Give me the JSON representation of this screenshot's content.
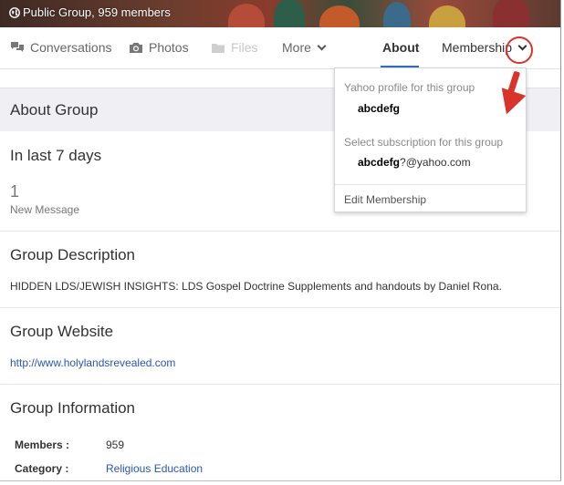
{
  "banner": {
    "group_status": "Public Group, 959 members"
  },
  "nav": {
    "conversations": "Conversations",
    "photos": "Photos",
    "files": "Files",
    "more": "More",
    "about": "About",
    "membership": "Membership"
  },
  "about": {
    "header": "About Group",
    "last7_title": "In last 7 days",
    "message_count": "1",
    "message_label": "New Message",
    "description_title": "Group Description",
    "description_text": "HIDDEN LDS/JEWISH INSIGHTS: LDS Gospel Doctrine Supplements and handouts by Daniel Rona.",
    "website_title": "Group Website",
    "website_url": "http://www.holylandsrevealed.com",
    "info_title": "Group Information",
    "members_label": "Members :",
    "members_value": "959",
    "category_label": "Category :",
    "category_value": "Religious Education"
  },
  "membership_menu": {
    "profile_label": "Yahoo profile for this group",
    "profile_name": "abcdefg",
    "subscription_label": "Select subscription for this group",
    "subscription_name": "abcdefg",
    "subscription_email_suffix": "?@yahoo.com",
    "edit_membership": "Edit Membership"
  },
  "colors": {
    "link": "#2a56b8",
    "annotation_red": "#d9342b",
    "active_tab": "#2f6fbf"
  },
  "icons": [
    "globe-icon",
    "speech-bubbles-icon",
    "camera-icon",
    "folder-icon",
    "chevron-down-icon"
  ]
}
